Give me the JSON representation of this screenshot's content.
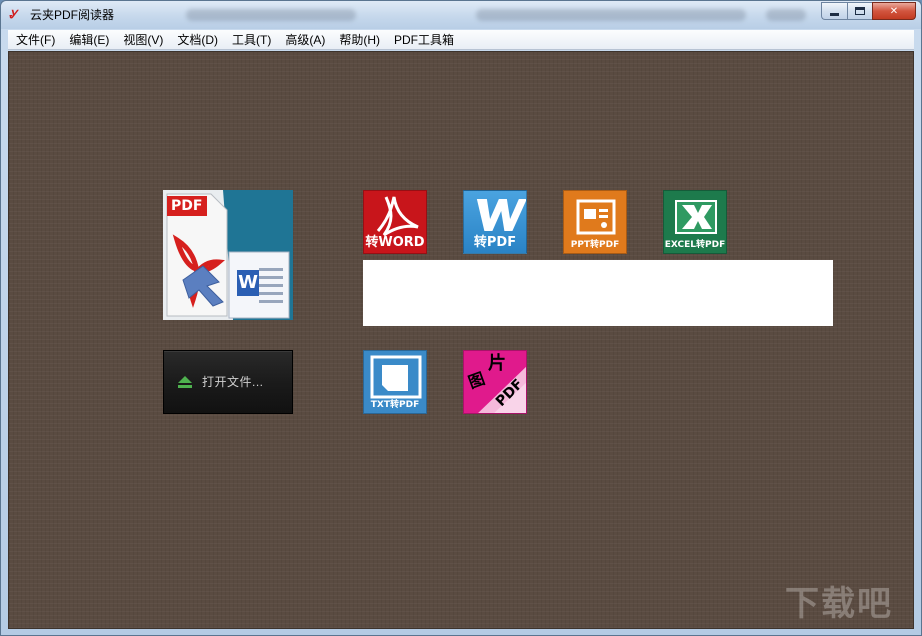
{
  "window": {
    "title": "云夹PDF阅读器",
    "icon": "yunjia-logo-icon"
  },
  "titlebar_buttons": {
    "minimize": "minimize-icon",
    "maximize": "maximize-icon",
    "close": "close-icon"
  },
  "menu": [
    {
      "label": "文件(F)"
    },
    {
      "label": "编辑(E)"
    },
    {
      "label": "视图(V)"
    },
    {
      "label": "文档(D)"
    },
    {
      "label": "工具(T)"
    },
    {
      "label": "高级(A)"
    },
    {
      "label": "帮助(H)"
    },
    {
      "label": "PDF工具箱"
    }
  ],
  "tiles": [
    {
      "label": "转WORD",
      "icon": "acrobat-icon",
      "color": "#c8151b"
    },
    {
      "label": "转PDF",
      "icon": "word-w-icon",
      "color": "#2f8fd0"
    },
    {
      "label": "PPT转PDF",
      "icon": "powerpoint-icon",
      "color": "#e07a1c"
    },
    {
      "label": "EXCEL转PDF",
      "icon": "excel-icon",
      "color": "#1d7a4c"
    },
    {
      "label": "TXT转PDF",
      "icon": "txt-document-icon",
      "color": "#3a8ac8"
    },
    {
      "label": "",
      "icon": "image-to-pdf-icon",
      "color": "#e01a8c"
    }
  ],
  "big_tile": {
    "icon": "pdf-to-word-icon",
    "pdf_label": "PDF",
    "word_label": "W"
  },
  "image_tile": {
    "text_top": "片",
    "text_mid": "图",
    "text_pdf": "PDF"
  },
  "open_button": {
    "label": "打开文件...",
    "icon": "eject-icon"
  },
  "watermark": {
    "text": "下载吧"
  }
}
